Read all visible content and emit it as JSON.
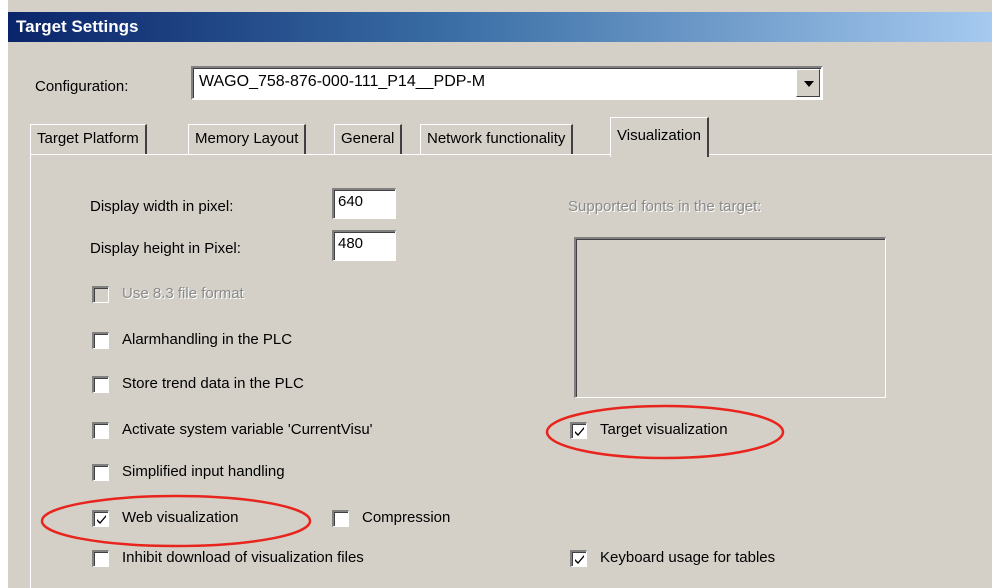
{
  "window": {
    "title": "Target Settings"
  },
  "configuration": {
    "label": "Configuration:",
    "value": "WAGO_758-876-000-111_P14__PDP-M"
  },
  "tabs": [
    {
      "label": "Target Platform"
    },
    {
      "label": "Memory Layout"
    },
    {
      "label": "General"
    },
    {
      "label": "Network functionality"
    },
    {
      "label": "Visualization",
      "active": true
    }
  ],
  "visualization": {
    "display_width": {
      "label": "Display width in pixel:",
      "value": "640"
    },
    "display_height": {
      "label": "Display height in Pixel:",
      "value": "480"
    },
    "options": {
      "use_83": {
        "label": "Use 8.3 file format",
        "checked": false,
        "disabled": true
      },
      "alarmhandling": {
        "label": "Alarmhandling in the PLC",
        "checked": false
      },
      "store_trend": {
        "label": "Store trend data in the PLC",
        "checked": false
      },
      "activate_currentvisu": {
        "label": "Activate system variable 'CurrentVisu'",
        "checked": false
      },
      "simplified_input": {
        "label": "Simplified input handling",
        "checked": false
      },
      "web_visualization": {
        "label": "Web visualization",
        "checked": true
      },
      "compression": {
        "label": "Compression",
        "checked": false
      },
      "inhibit_download": {
        "label": "Inhibit download of visualization files",
        "checked": false
      },
      "target_visualization": {
        "label": "Target visualization",
        "checked": true
      },
      "keyboard_tables": {
        "label": "Keyboard usage for tables",
        "checked": true
      }
    },
    "fonts": {
      "label": "Supported fonts in the target:",
      "items": []
    }
  },
  "colors": {
    "face": "#d4d0c8",
    "title_start": "#0a246a",
    "title_end": "#a6caf0",
    "highlight": "#e8241c"
  }
}
